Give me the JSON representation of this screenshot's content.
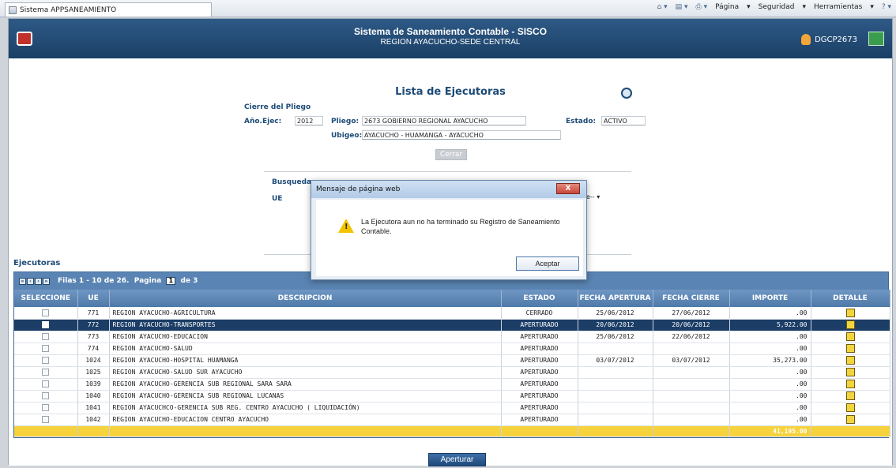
{
  "browser": {
    "tab_title": "Sistema APPSANEAMIENTO",
    "tools": [
      "Página",
      "Seguridad",
      "Herramientas"
    ]
  },
  "header": {
    "title": "Sistema de Saneamiento Contable - SISCO",
    "subtitle": "REGION AYACUCHO-SEDE CENTRAL",
    "user": "DGCP2673"
  },
  "page": {
    "title": "Lista de Ejecutoras",
    "section": "Cierre del Pliego",
    "anio_label": "Año.Ejec:",
    "anio_value": "2012",
    "pliego_label": "Pliego:",
    "pliego_value": "2673 GOBIERNO REGIONAL AYACUCHO",
    "estado_label": "Estado:",
    "estado_value": "ACTIVO",
    "ubigeo_label": "Ubigeo:",
    "ubigeo_value": "AYACUCHO - HUAMANGA - AYACUCHO",
    "cerrar_label": "Cerrar",
    "search_label": "Busqueda",
    "ue_label": "UE",
    "select_value": "one-- ▾"
  },
  "grid": {
    "title": "Ejecutoras",
    "pager_text": "Filas 1 - 10 de 26.",
    "page_label": "Pagina",
    "page_value": "1",
    "page_of": "de 3",
    "columns": [
      "SELECCIONE",
      "UE",
      "DESCRIPCION",
      "ESTADO",
      "FECHA APERTURA",
      "FECHA CIERRE",
      "IMPORTE",
      "DETALLE"
    ],
    "rows": [
      {
        "ue": "771",
        "desc": "REGION AYACUCHO-AGRICULTURA",
        "estado": "CERRADO",
        "apertura": "25/06/2012",
        "cierre": "27/06/2012",
        "importe": ".00"
      },
      {
        "ue": "772",
        "desc": "REGION AYACUCHO-TRANSPORTES",
        "estado": "APERTURADO",
        "apertura": "20/06/2012",
        "cierre": "20/06/2012",
        "importe": "5,922.00"
      },
      {
        "ue": "773",
        "desc": "REGION AYACUCHO-EDUCACION",
        "estado": "APERTURADO",
        "apertura": "25/06/2012",
        "cierre": "22/06/2012",
        "importe": ".00"
      },
      {
        "ue": "774",
        "desc": "REGION AYACUCHO-SALUD",
        "estado": "APERTURADO",
        "apertura": "",
        "cierre": "",
        "importe": ".00"
      },
      {
        "ue": "1024",
        "desc": "REGION AYACUCHO-HOSPITAL HUAMANGA",
        "estado": "APERTURADO",
        "apertura": "03/07/2012",
        "cierre": "03/07/2012",
        "importe": "35,273.00"
      },
      {
        "ue": "1025",
        "desc": "REGION AYACUCHO-SALUD SUR AYACUCHO",
        "estado": "APERTURADO",
        "apertura": "",
        "cierre": "",
        "importe": ".00"
      },
      {
        "ue": "1039",
        "desc": "REGION AYACUCHO-GERENCIA SUB REGIONAL SARA SARA",
        "estado": "APERTURADO",
        "apertura": "",
        "cierre": "",
        "importe": ".00"
      },
      {
        "ue": "1040",
        "desc": "REGION AYACUCHO-GERENCIA SUB REGIONAL LUCANAS",
        "estado": "APERTURADO",
        "apertura": "",
        "cierre": "",
        "importe": ".00"
      },
      {
        "ue": "1041",
        "desc": "REGION AYACUCHCO-GERENCIA SUB REG. CENTRO AYACUCHO ( LIQUIDACIÓN)",
        "estado": "APERTURADO",
        "apertura": "",
        "cierre": "",
        "importe": ".00"
      },
      {
        "ue": "1042",
        "desc": "REGION AYACUCHO-EDUCACION CENTRO AYACUCHO",
        "estado": "APERTURADO",
        "apertura": "",
        "cierre": "",
        "importe": ".00"
      }
    ],
    "total": "41,195.00"
  },
  "apertura_button": "Aperturar",
  "modal": {
    "title": "Mensaje de página web",
    "close": "X",
    "message": "La Ejecutora aun no ha terminado su Registro de Saneamiento Contable.",
    "button": "Aceptar"
  }
}
